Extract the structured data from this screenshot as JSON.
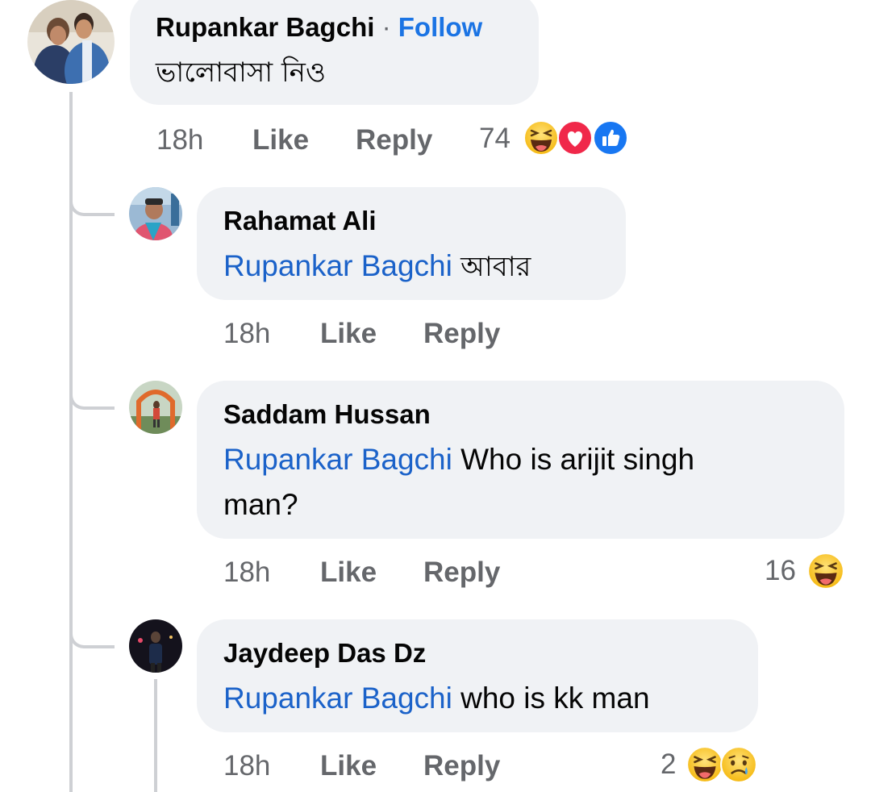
{
  "comments": [
    {
      "author": "Rupankar Bagchi",
      "separator": "·",
      "follow_label": "Follow",
      "text": "ভালোবাসা নিও",
      "time": "18h",
      "like_label": "Like",
      "reply_label": "Reply",
      "reaction_count": "74",
      "reactions": [
        "laugh-emoji",
        "love-icon",
        "like-icon"
      ]
    },
    {
      "author": "Rahamat Ali",
      "mention": "Rupankar Bagchi",
      "text": "আবার",
      "time": "18h",
      "like_label": "Like",
      "reply_label": "Reply"
    },
    {
      "author": "Saddam Hussan",
      "mention": "Rupankar Bagchi",
      "text_line1": "Who is arijit singh",
      "text_line2": "man?",
      "time": "18h",
      "like_label": "Like",
      "reply_label": "Reply",
      "reaction_count": "16",
      "reactions": [
        "laugh-emoji"
      ]
    },
    {
      "author": "Jaydeep Das Dz",
      "mention": "Rupankar Bagchi",
      "text": "who is kk man",
      "time": "18h",
      "like_label": "Like",
      "reply_label": "Reply",
      "reaction_count": "2",
      "reactions": [
        "laugh-emoji",
        "sad-emoji"
      ]
    }
  ],
  "colors": {
    "bubble": "#f0f2f5",
    "mention": "#1b62c9",
    "follow": "#1b74e4",
    "meta": "#65676b",
    "thread_line": "#ced0d4"
  }
}
